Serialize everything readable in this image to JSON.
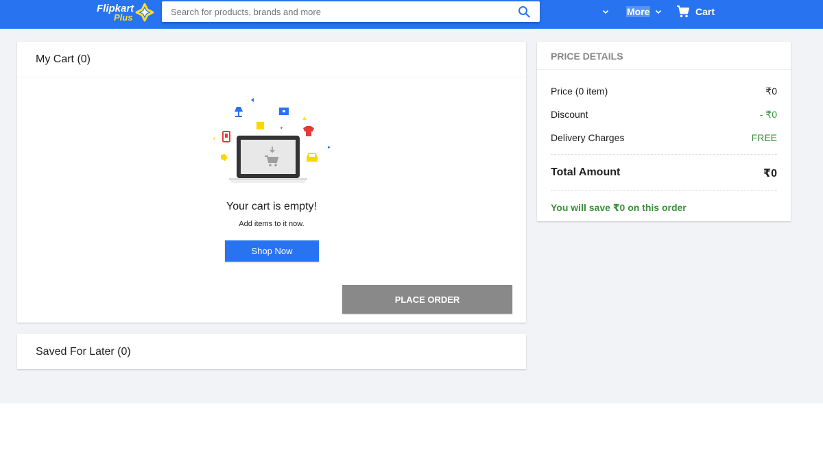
{
  "header": {
    "logo_line1": "Flipkart",
    "logo_line2": "Plus",
    "search_placeholder": "Search for products, brands and more",
    "search_value": "",
    "more_label": "More",
    "cart_label": "Cart",
    "colors": {
      "brand": "#2874f0",
      "logo_accent": "#ffe11b"
    },
    "icons": [
      "plus-star-icon",
      "search-icon",
      "chevron-down-icon",
      "cart-icon"
    ]
  },
  "cart": {
    "title": "My Cart (0)",
    "empty_title": "Your cart is empty!",
    "empty_subtitle": "Add items to it now.",
    "shop_now_label": "Shop Now",
    "place_order_label": "PLACE ORDER",
    "illustration_icons": [
      "laptop-cart-icon",
      "lamp-icon",
      "phone-icon",
      "book-icon",
      "tshirt-icon",
      "car-icon",
      "tag-icon",
      "card-icon"
    ]
  },
  "saved_for_later": {
    "title": "Saved For Later (0)"
  },
  "price_details": {
    "heading": "PRICE DETAILS",
    "rows": [
      {
        "label": "Price (0 item)",
        "value": "₹0"
      },
      {
        "label": "Discount",
        "value": "- ₹0"
      },
      {
        "label": "Delivery Charges",
        "value": "FREE"
      }
    ],
    "total_label": "Total Amount",
    "total_value": "₹0",
    "savings_text": "You will save ₹0 on this order",
    "colors": {
      "positive": "#388e3c"
    }
  }
}
